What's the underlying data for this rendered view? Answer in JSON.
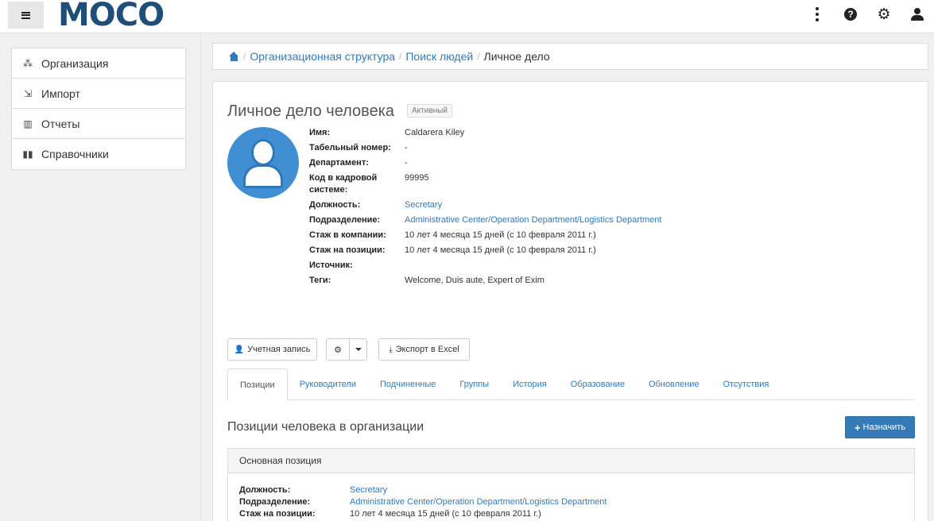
{
  "header": {
    "logo": "MOCO",
    "help_glyph": "?",
    "gear_glyph": "⚙"
  },
  "sidebar": {
    "items": [
      {
        "label": "Организация",
        "icon": "org-chart-icon",
        "glyph": "⁂"
      },
      {
        "label": "Импорт",
        "icon": "import-icon",
        "glyph": "⇲"
      },
      {
        "label": "Отчеты",
        "icon": "bar-chart-icon",
        "glyph": "▥"
      },
      {
        "label": "Справочники",
        "icon": "book-icon",
        "glyph": "▮▮"
      }
    ]
  },
  "breadcrumb": {
    "sep": "/",
    "items": [
      "Организационная структура",
      "Поиск людей"
    ],
    "current": "Личное дело"
  },
  "profile": {
    "title": "Личное дело человека",
    "status": "Активный",
    "fields": [
      {
        "label": "Имя:",
        "value": "Caldarera Kiley"
      },
      {
        "label": "Табельный номер:",
        "value": "-"
      },
      {
        "label": "Департамент:",
        "value": "-"
      },
      {
        "label": "Код в кадровой системе:",
        "value": "99995"
      },
      {
        "label": "Должность:",
        "value": "Secretary"
      },
      {
        "label": "Подразделение:",
        "value": "Administrative Center/Operation Department/Logistics Department"
      },
      {
        "label": "Стаж в компании:",
        "value": "10 лет 4 месяца 15 дней (с 10 февраля 2011 г.)"
      },
      {
        "label": "Стаж на позиции:",
        "value": "10 лет 4 месяца 15 дней (с 10 февраля 2011 г.)"
      },
      {
        "label": "Источник:",
        "value": ""
      },
      {
        "label": "Теги:",
        "value": "Welcome, Duis aute, Expert of Exim"
      }
    ]
  },
  "actions": {
    "account": "Учетная запись",
    "export": "Экспорт в Excel",
    "user_glyph": "👤",
    "gear_glyph": "⚙",
    "download_glyph": "⤓"
  },
  "tabs": [
    "Позиции",
    "Руководители",
    "Подчиненные",
    "Группы",
    "История",
    "Образование",
    "Обновление",
    "Отсутствия"
  ],
  "positions": {
    "title": "Позиции человека в организации",
    "assign_plus": "+",
    "assign_label": "Назначить",
    "panel_heading": "Основная позиция",
    "rows": [
      {
        "label": "Должность:",
        "value": "Secretary"
      },
      {
        "label": "Подразделение:",
        "value": "Administrative Center/Operation Department/Logistics Department"
      },
      {
        "label": "Стаж на позиции:",
        "value": "10 лет 4 месяца 15 дней (с 10 февраля 2011 г.)"
      }
    ]
  }
}
